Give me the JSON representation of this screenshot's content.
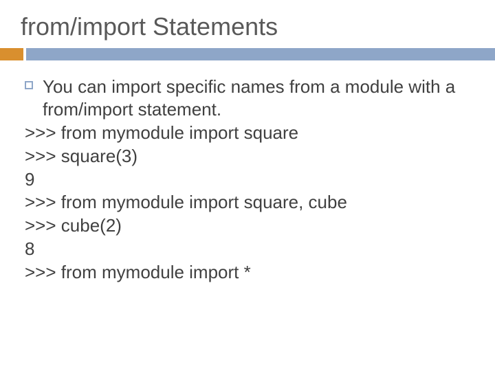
{
  "title": "from/import Statements",
  "bullet": "You can import specific names from a module with a from/import statement.",
  "lines": {
    "l1": ">>> from mymodule import square",
    "l2": ">>> square(3)",
    "l3": "9",
    "l4": ">>> from mymodule import square, cube",
    "l5": ">>> cube(2)",
    "l6": "8",
    "l7": ">>> from mymodule import *"
  }
}
